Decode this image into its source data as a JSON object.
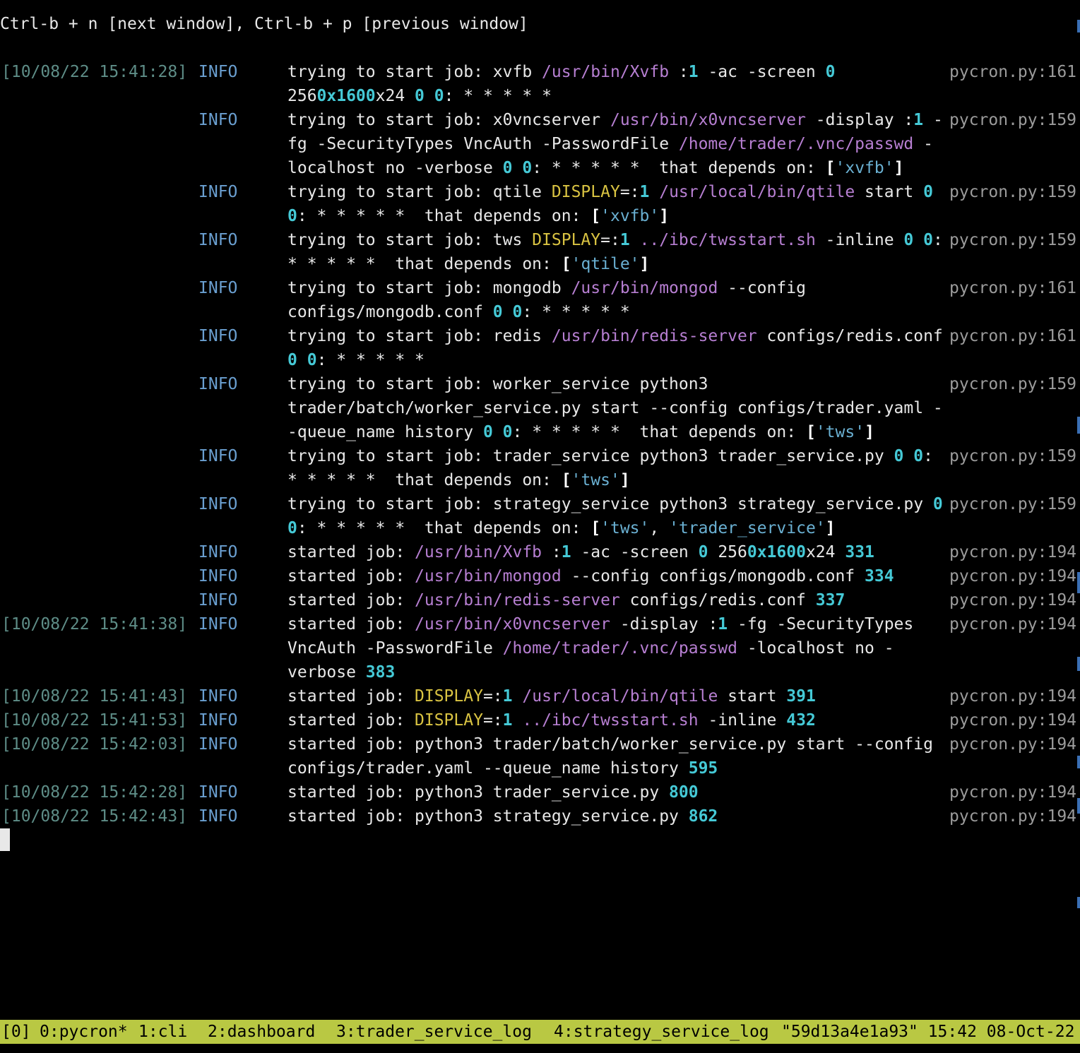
{
  "hint": "Ctrl-b + n [next window], Ctrl-b + p [previous window]",
  "log": [
    {
      "time": "[10/08/22 15:41:28]",
      "level": "INFO",
      "src": "pycron.py:161",
      "segments": [
        {
          "t": "trying to start job: xvfb ",
          "c": "text"
        },
        {
          "t": "/usr/bin/Xvfb",
          "c": "path"
        },
        {
          "t": " :",
          "c": "text"
        },
        {
          "t": "1",
          "c": "num"
        },
        {
          "t": " -ac -screen ",
          "c": "text"
        },
        {
          "t": "0",
          "c": "num"
        },
        {
          "t": " 256",
          "c": "text"
        },
        {
          "t": "0x1600",
          "c": "num"
        },
        {
          "t": "x24 ",
          "c": "text"
        },
        {
          "t": "0",
          "c": "num"
        },
        {
          "t": " ",
          "c": "text"
        },
        {
          "t": "0",
          "c": "num"
        },
        {
          "t": ": * * * * *",
          "c": "text"
        }
      ]
    },
    {
      "time": "",
      "level": "INFO",
      "src": "pycron.py:159",
      "segments": [
        {
          "t": "trying to start job: x0vncserver ",
          "c": "text"
        },
        {
          "t": "/usr/bin/x0vncserver",
          "c": "path"
        },
        {
          "t": " -display :",
          "c": "text"
        },
        {
          "t": "1",
          "c": "num"
        },
        {
          "t": " -fg -SecurityTypes VncAuth -PasswordFile ",
          "c": "text"
        },
        {
          "t": "/home/trader/.vnc/passwd",
          "c": "path"
        },
        {
          "t": " -localhost no -verbose ",
          "c": "text"
        },
        {
          "t": "0",
          "c": "num"
        },
        {
          "t": " ",
          "c": "text"
        },
        {
          "t": "0",
          "c": "num"
        },
        {
          "t": ": * * * * *  that depends on: ",
          "c": "text"
        },
        {
          "t": "[",
          "c": "bold"
        },
        {
          "t": "'xvfb'",
          "c": "str"
        },
        {
          "t": "]",
          "c": "bold"
        }
      ]
    },
    {
      "time": "",
      "level": "INFO",
      "src": "pycron.py:159",
      "segments": [
        {
          "t": "trying to start job: qtile ",
          "c": "text"
        },
        {
          "t": "DISPLAY",
          "c": "env"
        },
        {
          "t": "=:",
          "c": "text"
        },
        {
          "t": "1",
          "c": "num"
        },
        {
          "t": " ",
          "c": "text"
        },
        {
          "t": "/usr/local/bin/qtile",
          "c": "path"
        },
        {
          "t": " start ",
          "c": "text"
        },
        {
          "t": "0",
          "c": "num"
        },
        {
          "t": " ",
          "c": "text"
        },
        {
          "t": "0",
          "c": "num"
        },
        {
          "t": ": * * * * *  that depends on: ",
          "c": "text"
        },
        {
          "t": "[",
          "c": "bold"
        },
        {
          "t": "'xvfb'",
          "c": "str"
        },
        {
          "t": "]",
          "c": "bold"
        }
      ]
    },
    {
      "time": "",
      "level": "INFO",
      "src": "pycron.py:159",
      "segments": [
        {
          "t": "trying to start job: tws ",
          "c": "text"
        },
        {
          "t": "DISPLAY",
          "c": "env"
        },
        {
          "t": "=:",
          "c": "text"
        },
        {
          "t": "1",
          "c": "num"
        },
        {
          "t": " ",
          "c": "text"
        },
        {
          "t": "../ibc/twsstart.sh",
          "c": "path"
        },
        {
          "t": " -inline ",
          "c": "text"
        },
        {
          "t": "0",
          "c": "num"
        },
        {
          "t": " ",
          "c": "text"
        },
        {
          "t": "0",
          "c": "num"
        },
        {
          "t": ": * * * * *  that depends on: ",
          "c": "text"
        },
        {
          "t": "[",
          "c": "bold"
        },
        {
          "t": "'qtile'",
          "c": "str"
        },
        {
          "t": "]",
          "c": "bold"
        }
      ]
    },
    {
      "time": "",
      "level": "INFO",
      "src": "pycron.py:161",
      "segments": [
        {
          "t": "trying to start job: mongodb ",
          "c": "text"
        },
        {
          "t": "/usr/bin/mongod",
          "c": "path"
        },
        {
          "t": " --config configs/mongodb.conf ",
          "c": "text"
        },
        {
          "t": "0",
          "c": "num"
        },
        {
          "t": " ",
          "c": "text"
        },
        {
          "t": "0",
          "c": "num"
        },
        {
          "t": ": * * * * *",
          "c": "text"
        }
      ]
    },
    {
      "time": "",
      "level": "INFO",
      "src": "pycron.py:161",
      "segments": [
        {
          "t": "trying to start job: redis ",
          "c": "text"
        },
        {
          "t": "/usr/bin/redis-server",
          "c": "path"
        },
        {
          "t": " configs/redis.conf ",
          "c": "text"
        },
        {
          "t": "0",
          "c": "num"
        },
        {
          "t": " ",
          "c": "text"
        },
        {
          "t": "0",
          "c": "num"
        },
        {
          "t": ": * * * * *",
          "c": "text"
        }
      ]
    },
    {
      "time": "",
      "level": "INFO",
      "src": "pycron.py:159",
      "segments": [
        {
          "t": "trying to start job: worker_service python3 trader/batch/worker_service.py start --config configs/trader.yaml --queue_name history ",
          "c": "text"
        },
        {
          "t": "0",
          "c": "num"
        },
        {
          "t": " ",
          "c": "text"
        },
        {
          "t": "0",
          "c": "num"
        },
        {
          "t": ": * * * * *  that depends on: ",
          "c": "text"
        },
        {
          "t": "[",
          "c": "bold"
        },
        {
          "t": "'tws'",
          "c": "str"
        },
        {
          "t": "]",
          "c": "bold"
        }
      ]
    },
    {
      "time": "",
      "level": "INFO",
      "src": "pycron.py:159",
      "segments": [
        {
          "t": "trying to start job: trader_service python3 trader_service.py ",
          "c": "text"
        },
        {
          "t": "0",
          "c": "num"
        },
        {
          "t": " ",
          "c": "text"
        },
        {
          "t": "0",
          "c": "num"
        },
        {
          "t": ": * * * * *  that depends on: ",
          "c": "text"
        },
        {
          "t": "[",
          "c": "bold"
        },
        {
          "t": "'tws'",
          "c": "str"
        },
        {
          "t": "]",
          "c": "bold"
        }
      ]
    },
    {
      "time": "",
      "level": "INFO",
      "src": "pycron.py:159",
      "segments": [
        {
          "t": "trying to start job: strategy_service python3 strategy_service.py ",
          "c": "text"
        },
        {
          "t": "0",
          "c": "num"
        },
        {
          "t": " ",
          "c": "text"
        },
        {
          "t": "0",
          "c": "num"
        },
        {
          "t": ": * * * * *  that depends on: ",
          "c": "text"
        },
        {
          "t": "[",
          "c": "bold"
        },
        {
          "t": "'tws'",
          "c": "str"
        },
        {
          "t": ", ",
          "c": "text"
        },
        {
          "t": "'trader_service'",
          "c": "str"
        },
        {
          "t": "]",
          "c": "bold"
        }
      ]
    },
    {
      "time": "",
      "level": "INFO",
      "src": "pycron.py:194",
      "segments": [
        {
          "t": "started job: ",
          "c": "text"
        },
        {
          "t": "/usr/bin/Xvfb",
          "c": "path"
        },
        {
          "t": " :",
          "c": "text"
        },
        {
          "t": "1",
          "c": "num"
        },
        {
          "t": " -ac -screen ",
          "c": "text"
        },
        {
          "t": "0",
          "c": "num"
        },
        {
          "t": " 256",
          "c": "text"
        },
        {
          "t": "0x1600",
          "c": "num"
        },
        {
          "t": "x24 ",
          "c": "text"
        },
        {
          "t": "331",
          "c": "num"
        }
      ]
    },
    {
      "time": "",
      "level": "INFO",
      "src": "pycron.py:194",
      "segments": [
        {
          "t": "started job: ",
          "c": "text"
        },
        {
          "t": "/usr/bin/mongod",
          "c": "path"
        },
        {
          "t": " --config configs/mongodb.conf ",
          "c": "text"
        },
        {
          "t": "334",
          "c": "num"
        }
      ]
    },
    {
      "time": "",
      "level": "INFO",
      "src": "pycron.py:194",
      "segments": [
        {
          "t": "started job: ",
          "c": "text"
        },
        {
          "t": "/usr/bin/redis-server",
          "c": "path"
        },
        {
          "t": " configs/redis.conf ",
          "c": "text"
        },
        {
          "t": "337",
          "c": "num"
        }
      ]
    },
    {
      "time": "[10/08/22 15:41:38]",
      "level": "INFO",
      "src": "pycron.py:194",
      "segments": [
        {
          "t": "started job: ",
          "c": "text"
        },
        {
          "t": "/usr/bin/x0vncserver",
          "c": "path"
        },
        {
          "t": " -display :",
          "c": "text"
        },
        {
          "t": "1",
          "c": "num"
        },
        {
          "t": " -fg -SecurityTypes VncAuth -PasswordFile ",
          "c": "text"
        },
        {
          "t": "/home/trader/.vnc/passwd",
          "c": "path"
        },
        {
          "t": " -localhost no -verbose ",
          "c": "text"
        },
        {
          "t": "383",
          "c": "num"
        }
      ]
    },
    {
      "time": "[10/08/22 15:41:43]",
      "level": "INFO",
      "src": "pycron.py:194",
      "segments": [
        {
          "t": "started job: ",
          "c": "text"
        },
        {
          "t": "DISPLAY",
          "c": "env"
        },
        {
          "t": "=:",
          "c": "text"
        },
        {
          "t": "1",
          "c": "num"
        },
        {
          "t": " ",
          "c": "text"
        },
        {
          "t": "/usr/local/bin/qtile",
          "c": "path"
        },
        {
          "t": " start ",
          "c": "text"
        },
        {
          "t": "391",
          "c": "num"
        }
      ]
    },
    {
      "time": "[10/08/22 15:41:53]",
      "level": "INFO",
      "src": "pycron.py:194",
      "segments": [
        {
          "t": "started job: ",
          "c": "text"
        },
        {
          "t": "DISPLAY",
          "c": "env"
        },
        {
          "t": "=:",
          "c": "text"
        },
        {
          "t": "1",
          "c": "num"
        },
        {
          "t": " ",
          "c": "text"
        },
        {
          "t": "../ibc/twsstart.sh",
          "c": "path"
        },
        {
          "t": " -inline ",
          "c": "text"
        },
        {
          "t": "432",
          "c": "num"
        }
      ]
    },
    {
      "time": "[10/08/22 15:42:03]",
      "level": "INFO",
      "src": "pycron.py:194",
      "segments": [
        {
          "t": "started job: python3 trader/batch/worker_service.py start --config configs/trader.yaml --queue_name history ",
          "c": "text"
        },
        {
          "t": "595",
          "c": "num"
        }
      ]
    },
    {
      "time": "[10/08/22 15:42:28]",
      "level": "INFO",
      "src": "pycron.py:194",
      "segments": [
        {
          "t": "started job: python3 trader_service.py ",
          "c": "text"
        },
        {
          "t": "800",
          "c": "num"
        }
      ]
    },
    {
      "time": "[10/08/22 15:42:43]",
      "level": "INFO",
      "src": "pycron.py:194",
      "segments": [
        {
          "t": "started job: python3 strategy_service.py ",
          "c": "text"
        },
        {
          "t": "862",
          "c": "num"
        }
      ]
    }
  ],
  "statusbar": {
    "session": "[0]",
    "windows": [
      {
        "label": "0:pycron*",
        "active": true
      },
      {
        "label": "1:cli",
        "active": false
      },
      {
        "label": "2:dashboard",
        "active": false
      },
      {
        "label": "3:trader_service_log",
        "active": false
      },
      {
        "label": "4:strategy_service_log",
        "active": false
      }
    ],
    "right": "\"59d13a4e1a93\" 15:42 08-Oct-22"
  },
  "colors": {
    "background": "#000000",
    "text": "#e8e8e8",
    "timestamp": "#5e8d87",
    "level": "#6a9fd0",
    "source": "#9b9b9b",
    "path": "#b77fd2",
    "number": "#45c9d6",
    "string": "#6ab0d2",
    "env": "#d9c342",
    "statusbar": "#b9c843"
  }
}
